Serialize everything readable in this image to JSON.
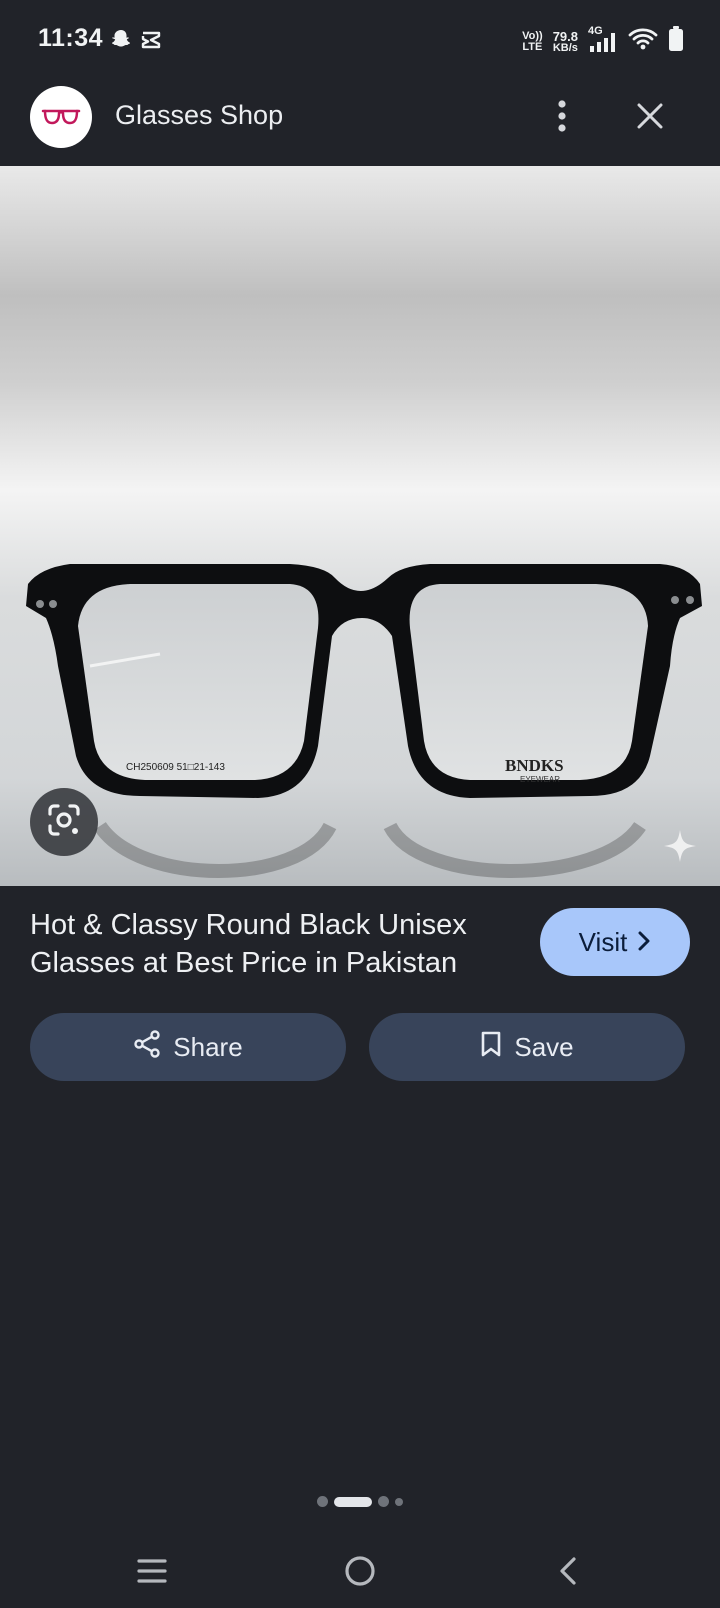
{
  "status_bar": {
    "time": "11:34",
    "volte_top": "Vo))",
    "volte_bottom": "LTE",
    "speed_value": "79.8",
    "speed_unit": "KB/s",
    "network_type": "4G"
  },
  "header": {
    "title": "Glasses Shop"
  },
  "product": {
    "title": "Hot & Classy Round Black Unisex Glasses at Best Price in Pakistan",
    "visit_label": "Visit",
    "share_label": "Share",
    "save_label": "Save",
    "image_frame_text": "CH250609  51□21-143",
    "image_brand": "BNDKS",
    "image_brand_sub": "EYEWEAR"
  },
  "page_indicator": {
    "count": 4,
    "active_index": 1
  },
  "colors": {
    "background": "#212329",
    "visit_button": "#a8c7fa",
    "action_button": "#38445a",
    "avatar_glasses": "#c2185b"
  },
  "icons": {
    "status": [
      "snapchat-icon",
      "capcut-icon",
      "signal-icon",
      "wifi-icon",
      "battery-icon"
    ],
    "header": [
      "glasses-logo-icon",
      "more-vert-icon",
      "close-icon"
    ],
    "actions": [
      "share-icon",
      "bookmark-icon",
      "chevron-right-icon",
      "lens-icon",
      "sparkle-icon"
    ],
    "nav": [
      "menu-icon",
      "home-icon",
      "back-icon"
    ]
  }
}
